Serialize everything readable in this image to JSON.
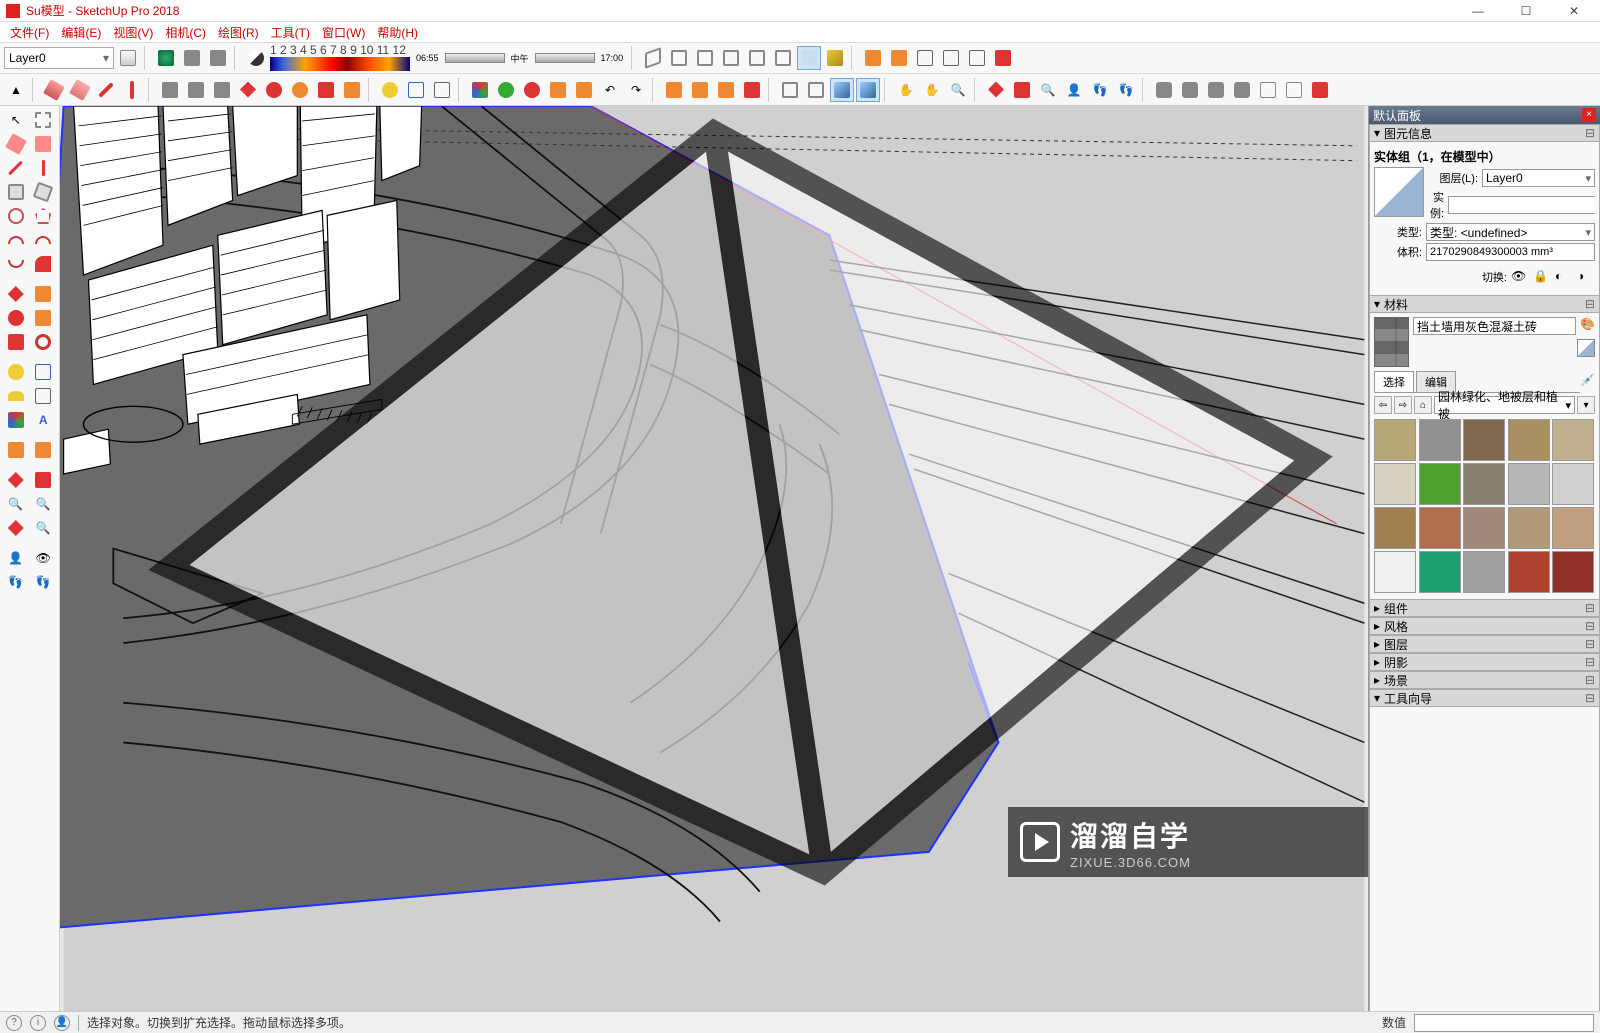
{
  "title": "Su模型 - SketchUp Pro 2018",
  "menu": [
    "文件(F)",
    "编辑(E)",
    "视图(V)",
    "相机(C)",
    "绘图(R)",
    "工具(T)",
    "窗口(W)",
    "帮助(H)"
  ],
  "layer_selector": "Layer0",
  "shadow": {
    "t1": "06:55",
    "mid": "中午",
    "t2": "17:00",
    "scale": "1 2 3 4 5 6 7 8 9 10 11 12"
  },
  "right": {
    "default_panel": "默认面板",
    "entity_info": {
      "title": "图元信息",
      "heading": "实体组（1，在模型中）",
      "layer_label": "图层(L):",
      "layer_value": "Layer0",
      "instance_label": "实例:",
      "instance_value": "",
      "type_label": "类型:",
      "type_value": "类型: <undefined>",
      "volume_label": "体积:",
      "volume_value": "2170290849300003 mm³",
      "toggle_label": "切换:"
    },
    "materials": {
      "title": "材料",
      "current_name": "挡土墙用灰色混凝土砖",
      "tab_select": "选择",
      "tab_edit": "编辑",
      "category": "园林绿化、地被层和植被"
    },
    "collapsed": [
      "组件",
      "风格",
      "图层",
      "阴影",
      "场景"
    ],
    "tool_guide": "工具向导"
  },
  "status": {
    "hint": "选择对象。切换到扩充选择。拖动鼠标选择多项。",
    "measure_label": "数值"
  },
  "watermark": {
    "cn": "溜溜自学",
    "url": "ZIXUE.3D66.COM"
  },
  "swatches": [
    "#b8a878",
    "#909090",
    "#806850",
    "#a89060",
    "#c0b090",
    "#d8d0c0",
    "#50a030",
    "#888070",
    "#b8b8b8",
    "#d0d0d0",
    "#a08050",
    "#b07050",
    "#a08878",
    "#b09878",
    "#c0a080",
    "#f0f0f0",
    "#20a070",
    "#a0a0a0",
    "#b04030",
    "#903028"
  ]
}
